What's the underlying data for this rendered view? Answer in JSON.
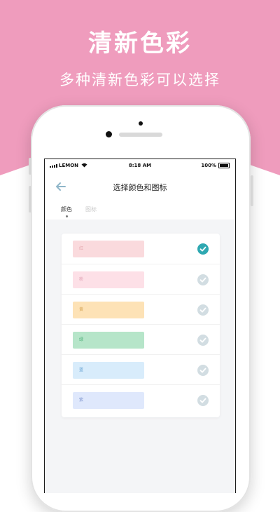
{
  "promo": {
    "title": "清新色彩",
    "subtitle": "多种清新色彩可以选择"
  },
  "colors": {
    "banner": "#ef9cbd",
    "selected_check": "#2ea8b1",
    "unselected_check": "#d2dde2"
  },
  "status_bar": {
    "carrier": "LEMON",
    "time": "8:18 AM",
    "battery": "100%"
  },
  "nav": {
    "back_icon": "arrow-left",
    "title": "选择颜色和图标"
  },
  "tabs": [
    {
      "label": "颜色",
      "active": true
    },
    {
      "label": "图标",
      "active": false
    }
  ],
  "color_options": [
    {
      "label": "红",
      "bg": "#fadadd",
      "text_color": "#e5a6ad",
      "selected": true
    },
    {
      "label": "粉",
      "bg": "#fde0e7",
      "text_color": "#e2a3b6",
      "selected": false
    },
    {
      "label": "黄",
      "bg": "#fde2b6",
      "text_color": "#d8a85a",
      "selected": false
    },
    {
      "label": "绿",
      "bg": "#b6e5c9",
      "text_color": "#4eb07a",
      "selected": false
    },
    {
      "label": "蓝",
      "bg": "#d8ecfb",
      "text_color": "#5c9ccf",
      "selected": false
    },
    {
      "label": "紫",
      "bg": "#dfe8fc",
      "text_color": "#7f96cf",
      "selected": false
    }
  ]
}
